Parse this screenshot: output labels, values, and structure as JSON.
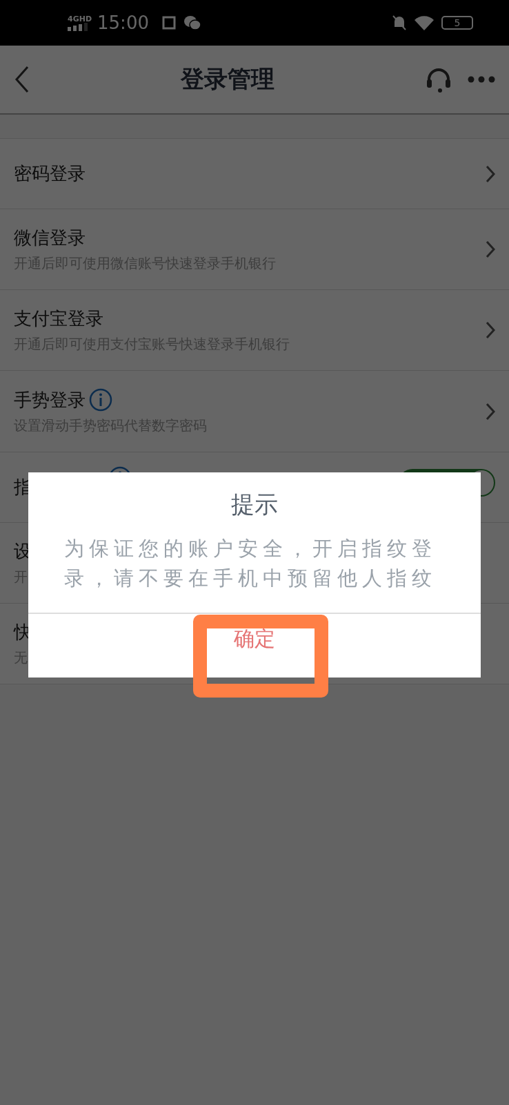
{
  "status_bar": {
    "network": "4GHD",
    "time": "15:00",
    "battery": "5"
  },
  "header": {
    "title": "登录管理"
  },
  "rows": [
    {
      "kind": "link",
      "title": "密码登录"
    },
    {
      "kind": "link",
      "title": "微信登录",
      "subtitle": "开通后即可使用微信账号快速登录手机银行"
    },
    {
      "kind": "link",
      "title": "支付宝登录",
      "subtitle": "开通后即可使用支付宝账号快速登录手机银行"
    },
    {
      "kind": "link",
      "title": "手势登录",
      "info": true,
      "subtitle": "设置滑动手势密码代替数字密码"
    },
    {
      "kind": "toggle",
      "title": "指",
      "info": true,
      "on": true
    },
    {
      "kind": "plain",
      "title": "设",
      "subtitle": "开"
    },
    {
      "kind": "plain",
      "title": "快",
      "subtitle": "无"
    }
  ],
  "dialog": {
    "title": "提示",
    "message": "为保证您的账户安全，开启指纹登录，请不要在手机中预留他人指纹",
    "button": "确定",
    "highlighted": true
  }
}
